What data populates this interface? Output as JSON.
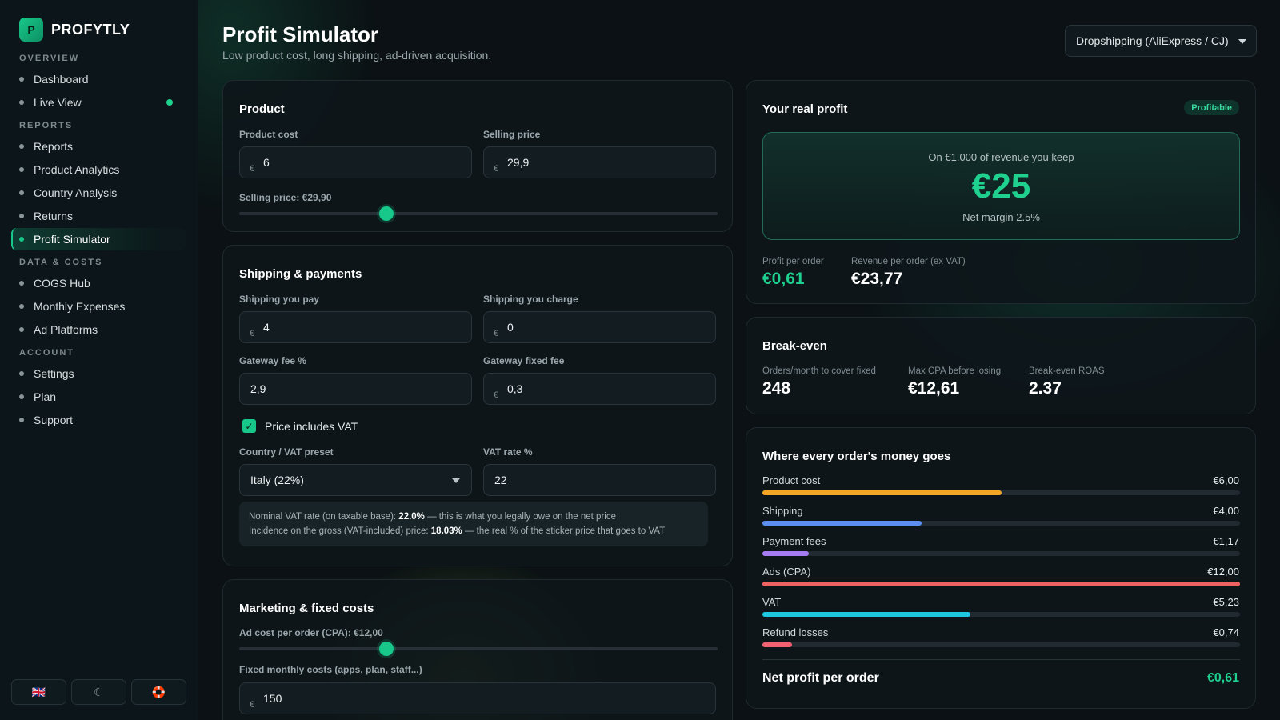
{
  "sidebar": {
    "brand_initial": "P",
    "brand_name": "PROFYTLY",
    "sections": {
      "overview": "OVERVIEW",
      "reports": "REPORTS",
      "data_costs": "DATA & COSTS",
      "account": "ACCOUNT"
    },
    "items": {
      "dashboard": "Dashboard",
      "live_view": "Live View",
      "reports": "Reports",
      "product_analytics": "Product Analytics",
      "country_analysis": "Country Analysis",
      "returns": "Returns",
      "profit_simulator": "Profit Simulator",
      "cogs_hub": "COGS Hub",
      "monthly_expenses": "Monthly Expenses",
      "ad_platforms": "Ad Platforms",
      "settings": "Settings",
      "plan": "Plan",
      "support": "Support"
    },
    "active_item": "Profit Simulator",
    "footer": {
      "language_flag": "🇬🇧",
      "theme_glyph": "☾",
      "help_glyph": "🛟"
    }
  },
  "header": {
    "title": "Profit Simulator",
    "subtitle": "Low product cost, long shipping, ad-driven acquisition.",
    "preset_selected": "Dropshipping (AliExpress / CJ)"
  },
  "product": {
    "title": "Product",
    "product_cost_label": "Product cost",
    "product_cost_value": "6",
    "selling_price_label": "Selling price",
    "selling_price_value": "29,9",
    "currency_prefix": "€",
    "slider_label": "Selling price: €29,90",
    "slider_level": 0.308
  },
  "shipping": {
    "title": "Shipping & payments",
    "ship_pay_label": "Shipping you pay",
    "ship_pay_value": "4",
    "ship_charge_label": "Shipping you charge",
    "ship_charge_value": "0",
    "gateway_pct_label": "Gateway fee %",
    "gateway_pct_value": "2,9",
    "gateway_fixed_label": "Gateway fixed fee",
    "gateway_fixed_value": "0,3",
    "vat_checkbox_label": "Price includes VAT",
    "vat_checked": true,
    "country_label": "Country / VAT preset",
    "country_value": "Italy (22%)",
    "vat_rate_label": "VAT rate %",
    "vat_rate_value": "22",
    "note_line1_prefix": "Nominal VAT rate (on taxable base): ",
    "note_line1_value": "22.0%",
    "note_line1_suffix": " — this is what you legally owe on the net price",
    "note_line2_prefix": "Incidence on the gross (VAT-included) price: ",
    "note_line2_value": "18.03%",
    "note_line2_suffix": " — the real % of the sticker price that goes to VAT"
  },
  "marketing": {
    "title": "Marketing & fixed costs",
    "cpa_label": "Ad cost per order (CPA): €12,00",
    "cpa_slider_level": 0.308,
    "fixed_label": "Fixed monthly costs (apps, plan, staff...)",
    "fixed_value": "150"
  },
  "real_profit": {
    "title": "Your real profit",
    "badge": "Profitable",
    "keep_caption": "On €1.000 of revenue you keep",
    "keep_value": "€25",
    "net_margin": "Net margin 2.5%",
    "profit_per_order_label": "Profit per order",
    "profit_per_order_value": "€0,61",
    "revenue_per_order_label": "Revenue per order (ex VAT)",
    "revenue_per_order_value": "€23,77"
  },
  "break_even": {
    "title": "Break-even",
    "orders_label": "Orders/month to cover fixed",
    "orders_value": "248",
    "max_cpa_label": "Max CPA before losing",
    "max_cpa_value": "€12,61",
    "roas_label": "Break-even ROAS",
    "roas_value": "2.37"
  },
  "money": {
    "title": "Where every order's money goes",
    "rows": [
      {
        "label": "Product cost",
        "value": "€6,00",
        "fraction": 0.5,
        "color": "#f5a524"
      },
      {
        "label": "Shipping",
        "value": "€4,00",
        "fraction": 0.333,
        "color": "#5b8ef0"
      },
      {
        "label": "Payment fees",
        "value": "€1,17",
        "fraction": 0.097,
        "color": "#a67cf2"
      },
      {
        "label": "Ads (CPA)",
        "value": "€12,00",
        "fraction": 1.0,
        "color": "#f06262"
      },
      {
        "label": "VAT",
        "value": "€5,23",
        "fraction": 0.436,
        "color": "#1fc8e0"
      },
      {
        "label": "Refund losses",
        "value": "€0,74",
        "fraction": 0.062,
        "color": "#f06272"
      }
    ],
    "net_label": "Net profit per order",
    "net_value": "€0,61"
  }
}
